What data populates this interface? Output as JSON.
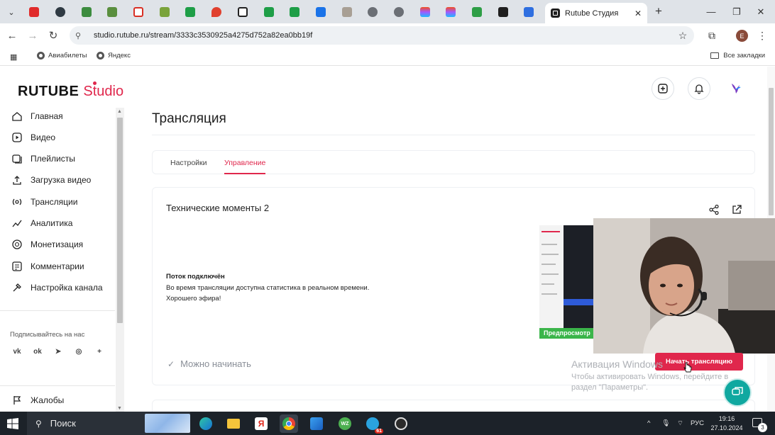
{
  "browser": {
    "active_tab_title": "Rutube Студия",
    "url": "studio.rutube.ru/stream/3333c3530925a4275d752a82ea0bb19f",
    "bookmarks": [
      "Авиабилеты",
      "Яндекс"
    ],
    "all_bookmarks_label": "Все закладки",
    "profile_initial": "E"
  },
  "app": {
    "logo_main": "RUTUBE",
    "logo_sub": "Studio",
    "brand_color": "#e0274c"
  },
  "sidebar": {
    "items": [
      {
        "label": "Главная",
        "icon": "home-icon"
      },
      {
        "label": "Видео",
        "icon": "video-icon"
      },
      {
        "label": "Плейлисты",
        "icon": "playlist-icon"
      },
      {
        "label": "Загрузка видео",
        "icon": "upload-icon"
      },
      {
        "label": "Трансляции",
        "icon": "broadcast-icon"
      },
      {
        "label": "Аналитика",
        "icon": "analytics-icon"
      },
      {
        "label": "Монетизация",
        "icon": "monetization-icon"
      },
      {
        "label": "Комментарии",
        "icon": "comments-icon"
      },
      {
        "label": "Настройка канала",
        "icon": "channel-settings-icon"
      }
    ],
    "subscribe_label": "Подписывайтесь на нас",
    "social": [
      "ВК",
      "ОК",
      "Telegram",
      "Viber",
      "+"
    ],
    "complaints_label": "Жалобы"
  },
  "main": {
    "page_title": "Трансляция",
    "tabs": [
      {
        "label": "Настройки",
        "active": false
      },
      {
        "label": "Управление",
        "active": true
      }
    ],
    "stream": {
      "title": "Технические моменты 2",
      "status_heading": "Поток подключён",
      "status_line1": "Во время трансляции доступна статистика в реальном времени.",
      "status_line2": "Хорошего эфира!",
      "preview_label": "Предпросмотр",
      "ready_label": "Можно начинать",
      "start_button": "Начать трансляцию"
    }
  },
  "windows_activation": {
    "title": "Активация Windows",
    "line1": "Чтобы активировать Windows, перейдите в",
    "line2": "раздел \"Параметры\"."
  },
  "taskbar": {
    "search_label": "Поиск",
    "telegram_badge": "61",
    "language": "РУС",
    "time": "19:16",
    "date": "27.10.2024",
    "notifications_count": "3"
  }
}
